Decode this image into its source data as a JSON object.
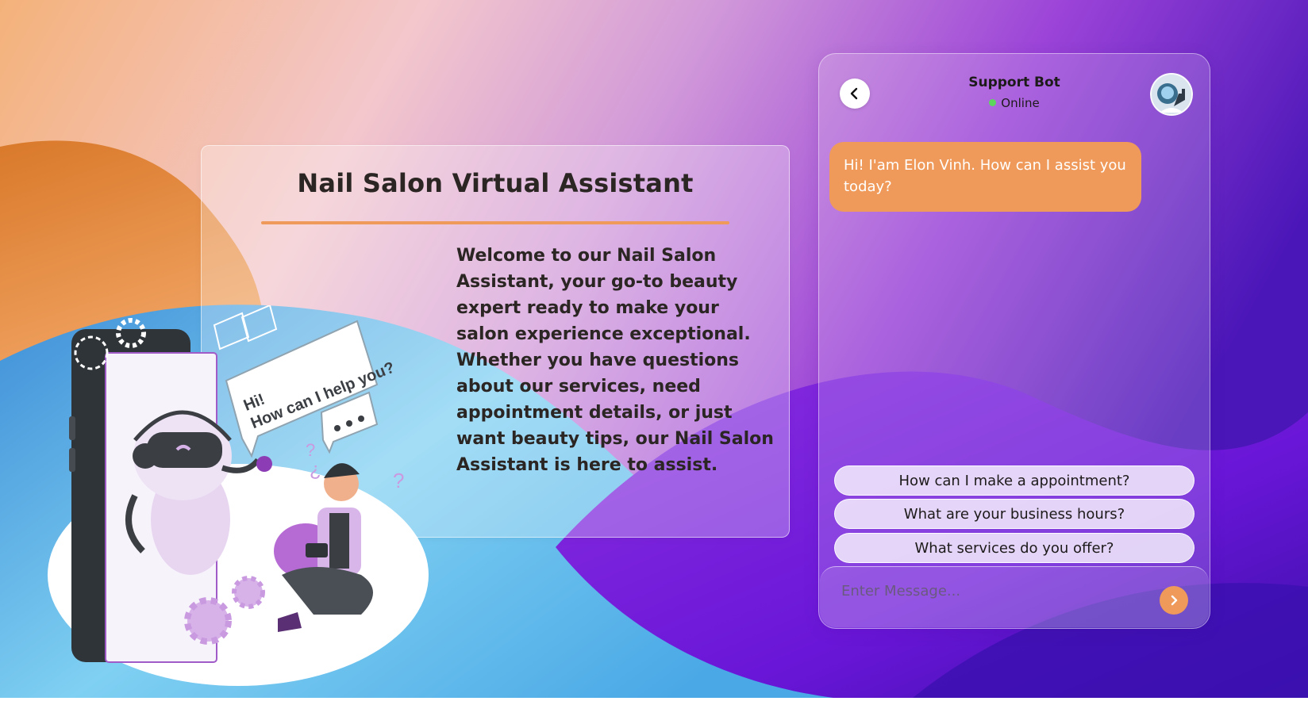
{
  "info": {
    "title": "Nail Salon Virtual Assistant",
    "description": "Welcome to our Nail Salon Assistant, your go-to beauty expert ready to make your salon experience exceptional. Whether you have questions about our services, need appointment details, or just want beauty tips, our Nail Salon Assistant is here to assist.",
    "accent_color": "#ef9a5a"
  },
  "illustration": {
    "speech_line1": "Hi!",
    "speech_line2": "How can I help you?"
  },
  "chat": {
    "title": "Support Bot",
    "status": "Online",
    "status_color": "#5cd65c",
    "back_icon": "chevron-left-icon",
    "avatar_icon": "robot-avatar",
    "messages": [
      {
        "sender": "bot",
        "text": "Hi! I'am Elon Vinh. How can I assist you today?"
      }
    ],
    "suggestions": [
      "How can I make a appointment?",
      "What are your business hours?",
      "What services do you offer?"
    ],
    "input_placeholder": "Enter Message...",
    "send_icon": "chevron-right-icon",
    "bubble_color": "#ef9a5a"
  }
}
